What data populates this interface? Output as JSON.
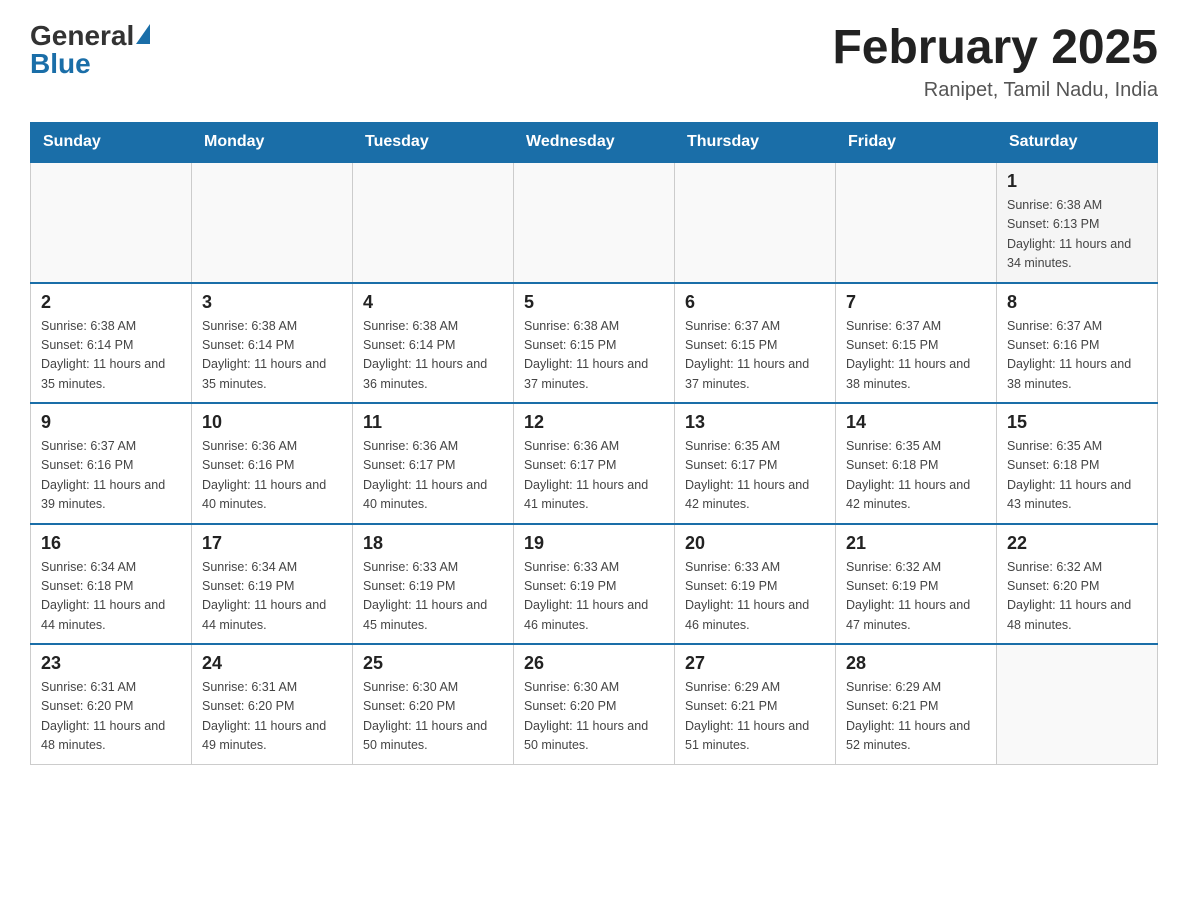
{
  "header": {
    "logo_general": "General",
    "logo_blue": "Blue",
    "title": "February 2025",
    "subtitle": "Ranipet, Tamil Nadu, India"
  },
  "days_of_week": [
    "Sunday",
    "Monday",
    "Tuesday",
    "Wednesday",
    "Thursday",
    "Friday",
    "Saturday"
  ],
  "weeks": [
    {
      "days": [
        {
          "number": "",
          "info": ""
        },
        {
          "number": "",
          "info": ""
        },
        {
          "number": "",
          "info": ""
        },
        {
          "number": "",
          "info": ""
        },
        {
          "number": "",
          "info": ""
        },
        {
          "number": "",
          "info": ""
        },
        {
          "number": "1",
          "info": "Sunrise: 6:38 AM\nSunset: 6:13 PM\nDaylight: 11 hours and 34 minutes."
        }
      ]
    },
    {
      "days": [
        {
          "number": "2",
          "info": "Sunrise: 6:38 AM\nSunset: 6:14 PM\nDaylight: 11 hours and 35 minutes."
        },
        {
          "number": "3",
          "info": "Sunrise: 6:38 AM\nSunset: 6:14 PM\nDaylight: 11 hours and 35 minutes."
        },
        {
          "number": "4",
          "info": "Sunrise: 6:38 AM\nSunset: 6:14 PM\nDaylight: 11 hours and 36 minutes."
        },
        {
          "number": "5",
          "info": "Sunrise: 6:38 AM\nSunset: 6:15 PM\nDaylight: 11 hours and 37 minutes."
        },
        {
          "number": "6",
          "info": "Sunrise: 6:37 AM\nSunset: 6:15 PM\nDaylight: 11 hours and 37 minutes."
        },
        {
          "number": "7",
          "info": "Sunrise: 6:37 AM\nSunset: 6:15 PM\nDaylight: 11 hours and 38 minutes."
        },
        {
          "number": "8",
          "info": "Sunrise: 6:37 AM\nSunset: 6:16 PM\nDaylight: 11 hours and 38 minutes."
        }
      ]
    },
    {
      "days": [
        {
          "number": "9",
          "info": "Sunrise: 6:37 AM\nSunset: 6:16 PM\nDaylight: 11 hours and 39 minutes."
        },
        {
          "number": "10",
          "info": "Sunrise: 6:36 AM\nSunset: 6:16 PM\nDaylight: 11 hours and 40 minutes."
        },
        {
          "number": "11",
          "info": "Sunrise: 6:36 AM\nSunset: 6:17 PM\nDaylight: 11 hours and 40 minutes."
        },
        {
          "number": "12",
          "info": "Sunrise: 6:36 AM\nSunset: 6:17 PM\nDaylight: 11 hours and 41 minutes."
        },
        {
          "number": "13",
          "info": "Sunrise: 6:35 AM\nSunset: 6:17 PM\nDaylight: 11 hours and 42 minutes."
        },
        {
          "number": "14",
          "info": "Sunrise: 6:35 AM\nSunset: 6:18 PM\nDaylight: 11 hours and 42 minutes."
        },
        {
          "number": "15",
          "info": "Sunrise: 6:35 AM\nSunset: 6:18 PM\nDaylight: 11 hours and 43 minutes."
        }
      ]
    },
    {
      "days": [
        {
          "number": "16",
          "info": "Sunrise: 6:34 AM\nSunset: 6:18 PM\nDaylight: 11 hours and 44 minutes."
        },
        {
          "number": "17",
          "info": "Sunrise: 6:34 AM\nSunset: 6:19 PM\nDaylight: 11 hours and 44 minutes."
        },
        {
          "number": "18",
          "info": "Sunrise: 6:33 AM\nSunset: 6:19 PM\nDaylight: 11 hours and 45 minutes."
        },
        {
          "number": "19",
          "info": "Sunrise: 6:33 AM\nSunset: 6:19 PM\nDaylight: 11 hours and 46 minutes."
        },
        {
          "number": "20",
          "info": "Sunrise: 6:33 AM\nSunset: 6:19 PM\nDaylight: 11 hours and 46 minutes."
        },
        {
          "number": "21",
          "info": "Sunrise: 6:32 AM\nSunset: 6:19 PM\nDaylight: 11 hours and 47 minutes."
        },
        {
          "number": "22",
          "info": "Sunrise: 6:32 AM\nSunset: 6:20 PM\nDaylight: 11 hours and 48 minutes."
        }
      ]
    },
    {
      "days": [
        {
          "number": "23",
          "info": "Sunrise: 6:31 AM\nSunset: 6:20 PM\nDaylight: 11 hours and 48 minutes."
        },
        {
          "number": "24",
          "info": "Sunrise: 6:31 AM\nSunset: 6:20 PM\nDaylight: 11 hours and 49 minutes."
        },
        {
          "number": "25",
          "info": "Sunrise: 6:30 AM\nSunset: 6:20 PM\nDaylight: 11 hours and 50 minutes."
        },
        {
          "number": "26",
          "info": "Sunrise: 6:30 AM\nSunset: 6:20 PM\nDaylight: 11 hours and 50 minutes."
        },
        {
          "number": "27",
          "info": "Sunrise: 6:29 AM\nSunset: 6:21 PM\nDaylight: 11 hours and 51 minutes."
        },
        {
          "number": "28",
          "info": "Sunrise: 6:29 AM\nSunset: 6:21 PM\nDaylight: 11 hours and 52 minutes."
        },
        {
          "number": "",
          "info": ""
        }
      ]
    }
  ]
}
